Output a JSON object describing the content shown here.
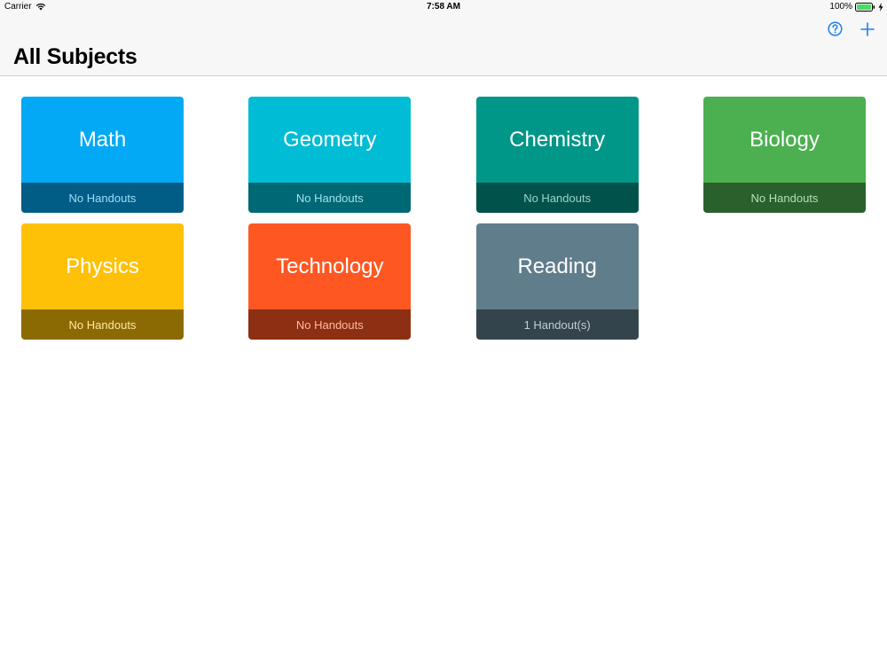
{
  "status_bar": {
    "carrier": "Carrier",
    "time": "7:58 AM",
    "battery_percent": "100%",
    "wifi_icon": "wifi-icon",
    "battery_icon": "battery-icon",
    "charging_icon": "charging-bolt-icon"
  },
  "nav": {
    "title": "All Subjects",
    "help_icon": "help-circle-icon",
    "add_icon": "plus-icon",
    "accent_color": "#1a7ff0"
  },
  "subjects": [
    {
      "name": "Math",
      "handouts": "No Handouts",
      "color": "#03a9f4",
      "caption_color": "#9fdcf7"
    },
    {
      "name": "Geometry",
      "handouts": "No Handouts",
      "color": "#00bcd4",
      "caption_color": "#9ee3ec"
    },
    {
      "name": "Chemistry",
      "handouts": "No Handouts",
      "color": "#009688",
      "caption_color": "#9bd3cc"
    },
    {
      "name": "Biology",
      "handouts": "No Handouts",
      "color": "#4caf50",
      "caption_color": "#b8dfb9"
    },
    {
      "name": "Physics",
      "handouts": "No Handouts",
      "color": "#ffc107",
      "caption_color": "#ffe7a0"
    },
    {
      "name": "Technology",
      "handouts": "No Handouts",
      "color": "#ff5722",
      "caption_color": "#ffb8a1"
    },
    {
      "name": "Reading",
      "handouts": "1 Handout(s)",
      "color": "#607d8b",
      "caption_color": "#c3ced3"
    }
  ]
}
